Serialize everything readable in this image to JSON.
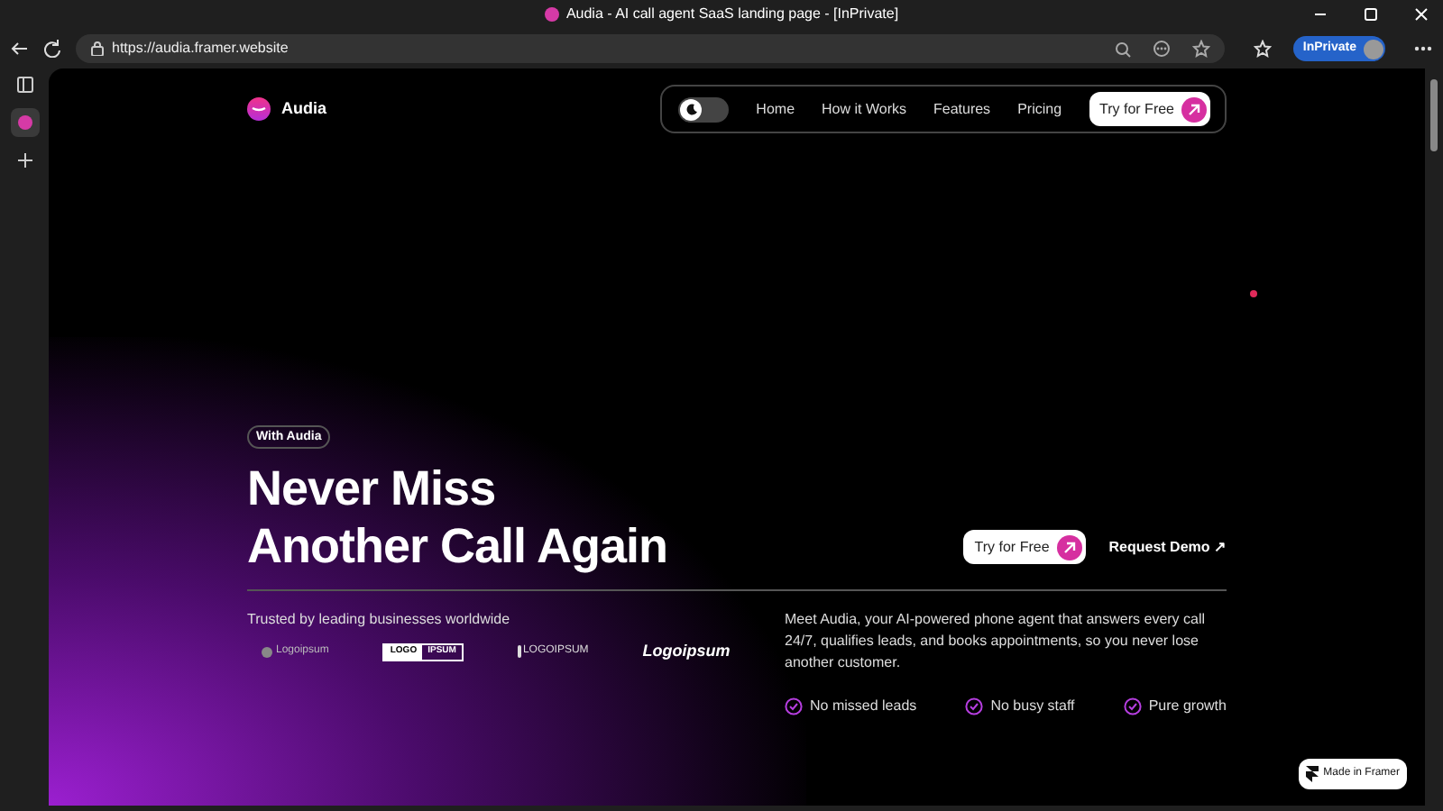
{
  "window": {
    "title": "Audia - AI call agent SaaS landing page - [InPrivate]"
  },
  "browser": {
    "url": "https://audia.framer.website",
    "profile": "InPrivate"
  },
  "nav": {
    "brand": "Audia",
    "light_mode": false,
    "links": [
      "Home",
      "How it Works",
      "Features",
      "Pricing"
    ],
    "cta": "Try for Free"
  },
  "hero": {
    "badge": "With Audia",
    "headline": [
      "Never Miss",
      "Another Call Again"
    ],
    "primary_button": "Try for Free",
    "secondary_button": "Request Demo ↗"
  },
  "trusted": {
    "label": "Trusted by leading businesses worldwide",
    "logos": [
      {
        "kind": "soft",
        "text": "Logoipsum"
      },
      {
        "kind": "boxed",
        "text": "LOGO",
        "text2": "IPSUM"
      },
      {
        "kind": "pin",
        "text": "LOGOIPSUM"
      },
      {
        "kind": "italic",
        "text": "Logoipsum"
      }
    ]
  },
  "description": "Meet Audia, your AI-powered phone agent that answers every call 24/7, qualifies leads, and books appointments, so you never lose another customer.",
  "features": [
    "No missed leads",
    "No busy staff",
    "Pure growth"
  ],
  "framer_badge": "Made in Framer"
}
